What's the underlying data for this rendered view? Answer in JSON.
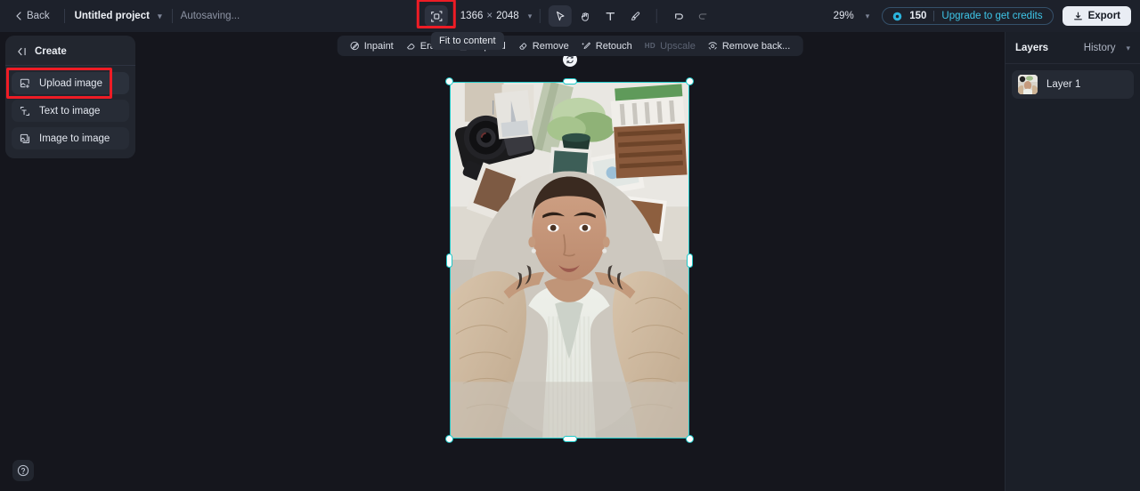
{
  "topbar": {
    "back_label": "Back",
    "project_name": "Untitled project",
    "autosave_status": "Autosaving...",
    "fit_to_content_tooltip": "Fit to content",
    "canvas_width": "1366",
    "canvas_dim_separator": "×",
    "canvas_height": "2048",
    "zoom_level": "29%",
    "credits_count": "150",
    "upgrade_label": "Upgrade to get credits",
    "export_label": "Export",
    "tools": [
      {
        "name": "select-tool",
        "icon": "cursor-icon",
        "active": true,
        "disabled": false
      },
      {
        "name": "hand-tool",
        "icon": "hand-icon",
        "active": false,
        "disabled": false
      },
      {
        "name": "text-tool",
        "icon": "text-icon",
        "active": false,
        "disabled": false
      },
      {
        "name": "brush-tool",
        "icon": "brush-icon",
        "active": false,
        "disabled": false
      },
      {
        "name": "undo",
        "icon": "undo-icon",
        "active": false,
        "disabled": false
      },
      {
        "name": "redo",
        "icon": "redo-icon",
        "active": false,
        "disabled": true
      }
    ]
  },
  "sidebar": {
    "title": "Create",
    "collapse_icon": "collapse-left-icon",
    "items": [
      {
        "label": "Upload image",
        "icon": "upload-image-icon",
        "selected": true,
        "highlighted": true
      },
      {
        "label": "Text to image",
        "icon": "text-to-image-icon",
        "selected": false,
        "highlighted": false
      },
      {
        "label": "Image to image",
        "icon": "image-to-image-icon",
        "selected": false,
        "highlighted": false
      }
    ]
  },
  "context_toolbar": {
    "items": [
      {
        "label": "Inpaint",
        "icon": "inpaint-icon",
        "disabled": false,
        "tag": ""
      },
      {
        "label": "Erase",
        "icon": "erase-icon",
        "disabled": false,
        "tag": ""
      },
      {
        "label": "Expand",
        "icon": "expand-icon",
        "disabled": false,
        "tag": ""
      },
      {
        "label": "Remove",
        "icon": "remove-icon",
        "disabled": false,
        "tag": ""
      },
      {
        "label": "Retouch",
        "icon": "retouch-icon",
        "disabled": false,
        "tag": ""
      },
      {
        "label": "Upscale",
        "icon": "upscale-icon",
        "disabled": true,
        "tag": "HD"
      },
      {
        "label": "Remove back...",
        "icon": "remove-background-icon",
        "disabled": false,
        "tag": ""
      }
    ]
  },
  "canvas": {
    "selection_color": "#1ec8c8",
    "rotate_icon": "rotate-icon",
    "image_alt": "flat-lay photo of woman lying on rug surrounded by camera, plants and printed photos"
  },
  "layers_panel": {
    "title": "Layers",
    "history_label": "History",
    "history_caret_icon": "chevron-down-icon",
    "layers": [
      {
        "name": "Layer 1",
        "thumbnail": "layer-thumbnail"
      }
    ]
  },
  "help": {
    "icon": "help-circle-icon",
    "label": "?"
  },
  "colors": {
    "app_background": "#15161d",
    "topbar_background": "#1d212b",
    "panel_background": "#22262f",
    "accent_selection": "#1ec8c8",
    "accent_link": "#3ec6e8",
    "annotation_red": "#ee1c25"
  }
}
